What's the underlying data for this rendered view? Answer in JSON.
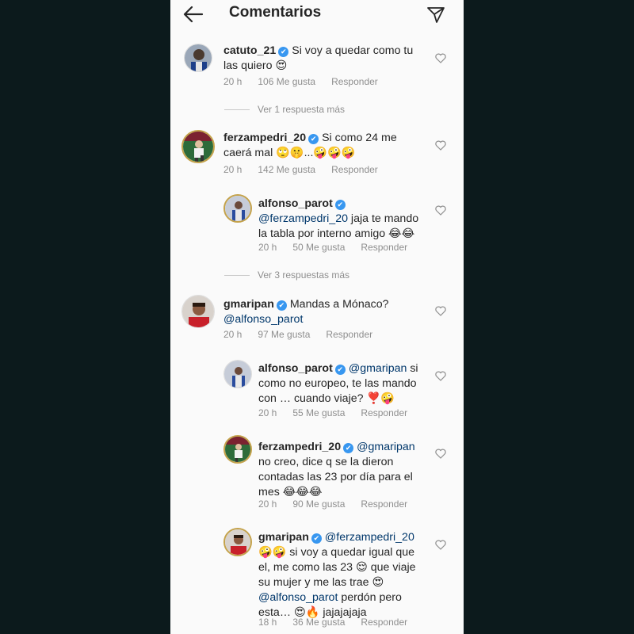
{
  "header": {
    "title": "Comentarios"
  },
  "icons": {
    "back": "arrow-left-icon",
    "send": "paper-plane-icon",
    "like": "heart-icon",
    "verified": "verified-badge-icon"
  },
  "colors": {
    "background": "#fafafa",
    "verified": "#3897f0",
    "mention": "#00376b",
    "meta": "#8e8e8e",
    "outer": "#0c1a1c"
  },
  "comments": [
    {
      "user": "catuto_21",
      "text": "Si voy a quedar como tu las quiero 😍",
      "time": "20 h",
      "likes": "106 Me gusta",
      "reply": "Responder",
      "view_more": "Ver 1 respuesta más"
    },
    {
      "user": "ferzampedri_20",
      "text": "Si como 24 me caerá mal 🙄🤫...🤪🤪🤪",
      "time": "20 h",
      "likes": "142 Me gusta",
      "reply": "Responder",
      "replies": [
        {
          "user": "alfonso_parot",
          "mention": "@ferzampedri_20",
          "text": " jaja te mando la tabla por interno amigo 😂😂",
          "time": "20 h",
          "likes": "50 Me gusta",
          "reply": "Responder"
        }
      ],
      "view_more": "Ver 3 respuestas más"
    },
    {
      "user": "gmaripan",
      "text": "Mandas a Mónaco?",
      "mention": "@alfonso_parot",
      "time": "20 h",
      "likes": "97 Me gusta",
      "reply": "Responder",
      "replies": [
        {
          "user": "alfonso_parot",
          "mention": "@gmaripan",
          "text": " si como no europeo, te las mando con … cuando viaje? ❣️🤪",
          "time": "20 h",
          "likes": "55 Me gusta",
          "reply": "Responder"
        },
        {
          "user": "ferzampedri_20",
          "mention": "@gmaripan",
          "text": " no creo, dice q se la dieron contadas las 23 por día para el mes 😂😂😂",
          "time": "20 h",
          "likes": "90 Me gusta",
          "reply": "Responder"
        },
        {
          "user": "gmaripan",
          "mention": "@ferzampedri_20",
          "text": " 🤪🤪 si voy a quedar igual que el, me como las 23 😌 que viaje su mujer y me las trae 😍",
          "mention2": "@alfonso_parot",
          "text2": " perdón  pero esta… 😍🔥 jajajajaja",
          "time": "18 h",
          "likes": "36 Me gusta",
          "reply": "Responder"
        }
      ]
    }
  ]
}
